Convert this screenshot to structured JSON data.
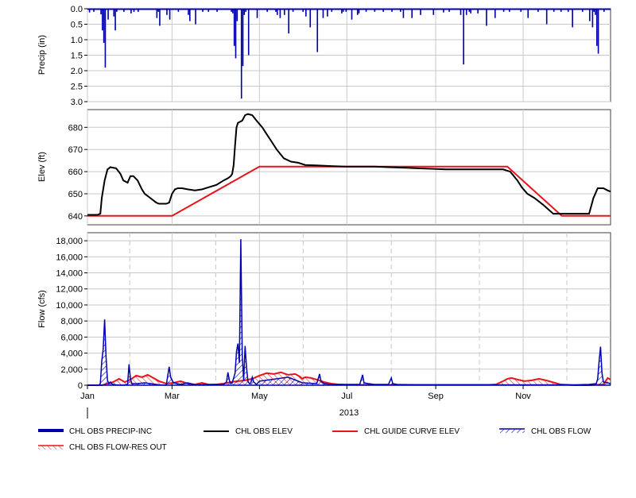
{
  "colors": {
    "precip": "#0000a8",
    "obs_elev": "#000000",
    "guide_curve": "#e8141c",
    "obs_flow": "#0000b4",
    "flow_res_out": "#e8141c",
    "grid": "#c8c8c8",
    "frame": "#404040"
  },
  "x_axis": {
    "tick_labels": [
      "Jan",
      "Mar",
      "May",
      "Jul",
      "Sep",
      "Nov"
    ],
    "tick_days": [
      0,
      59,
      120,
      181,
      243,
      304
    ],
    "range_days": [
      0,
      365
    ],
    "year_label": "2013"
  },
  "legend": {
    "precip": "CHL OBS PRECIP-INC",
    "obs_elev": "CHL OBS ELEV",
    "guide_curve": "CHL GUIDE CURVE ELEV",
    "obs_flow": "CHL OBS FLOW",
    "flow_res_out": "CHL OBS FLOW-RES OUT"
  },
  "chart_data": [
    {
      "type": "bar",
      "ylabel": "Precip (in)",
      "ylim": [
        0.0,
        3.0
      ],
      "y_inverted": true,
      "yticks": [
        "0.0",
        "0.5",
        "1.0",
        "1.5",
        "2.0",
        "2.5",
        "3.0"
      ],
      "series": [
        {
          "name": "CHL OBS PRECIP-INC",
          "x_days": [
            1,
            4,
            9,
            10,
            11,
            12,
            14,
            18,
            19,
            20,
            25,
            30,
            32,
            35,
            48,
            49,
            50,
            55,
            57,
            63,
            70,
            71,
            75,
            80,
            84,
            90,
            100,
            101,
            102,
            103,
            104,
            107,
            108,
            109,
            110,
            112,
            118,
            125,
            131,
            132,
            134,
            137,
            140,
            143,
            150,
            152,
            155,
            160,
            164,
            167,
            170,
            177,
            178,
            180,
            184,
            188,
            189,
            194,
            200,
            206,
            212,
            218,
            220,
            226,
            232,
            241,
            248,
            252,
            260,
            262,
            264,
            266,
            267,
            272,
            278,
            284,
            290,
            294,
            302,
            307,
            314,
            320,
            325,
            330,
            335,
            338,
            345,
            350,
            352,
            353,
            354,
            355,
            356,
            360
          ],
          "values": [
            0.12,
            0.1,
            0.18,
            0.7,
            1.1,
            1.9,
            0.35,
            0.25,
            0.7,
            0.1,
            0.1,
            0.15,
            0.1,
            0.1,
            0.3,
            0.1,
            0.55,
            0.2,
            0.35,
            0.1,
            0.2,
            0.4,
            0.5,
            0.1,
            0.1,
            0.1,
            0.1,
            0.15,
            1.2,
            1.6,
            0.4,
            2.9,
            1.85,
            0.2,
            0.1,
            1.5,
            0.3,
            0.1,
            0.1,
            0.2,
            0.3,
            0.2,
            0.8,
            0.1,
            0.1,
            0.25,
            0.6,
            1.4,
            0.3,
            0.25,
            0.1,
            0.15,
            0.1,
            0.1,
            0.35,
            0.2,
            0.15,
            0.1,
            0.1,
            0.1,
            0.1,
            0.1,
            0.3,
            0.3,
            0.2,
            0.2,
            0.12,
            0.1,
            0.2,
            1.8,
            0.2,
            0.1,
            0.15,
            0.15,
            0.55,
            0.3,
            0.1,
            0.1,
            0.1,
            0.3,
            0.1,
            0.5,
            0.1,
            0.1,
            0.1,
            0.6,
            0.1,
            0.4,
            0.6,
            0.1,
            0.2,
            1.2,
            1.45,
            0.1
          ]
        }
      ]
    },
    {
      "type": "line",
      "ylabel": "Elev (ft)",
      "ylim": [
        636,
        688
      ],
      "yticks": [
        640,
        650,
        660,
        670,
        680
      ],
      "series": [
        {
          "name": "CHL OBS ELEV",
          "x_days": [
            0,
            7,
            9,
            10,
            12,
            14,
            16,
            20,
            23,
            25,
            28,
            30,
            32,
            35,
            38,
            40,
            44,
            48,
            50,
            52,
            55,
            57,
            59,
            61,
            63,
            66,
            70,
            75,
            80,
            85,
            90,
            95,
            98,
            100,
            101,
            102,
            103,
            104,
            105,
            108,
            110,
            112,
            115,
            118,
            122,
            125,
            128,
            132,
            137,
            142,
            147,
            152,
            160,
            170,
            180,
            190,
            200,
            210,
            220,
            230,
            240,
            250,
            260,
            270,
            280,
            290,
            295,
            300,
            303,
            307,
            312,
            318,
            325,
            331,
            335,
            340,
            345,
            350,
            353,
            356,
            360,
            363,
            365
          ],
          "values": [
            640.5,
            640.5,
            641,
            648,
            656,
            661,
            662,
            661.5,
            659,
            656,
            655,
            658,
            658,
            656,
            652,
            650,
            648,
            646,
            645.5,
            645.5,
            645.5,
            646,
            650,
            652,
            652.5,
            652.5,
            652,
            651.5,
            652,
            653,
            654,
            656,
            657,
            658,
            659,
            663,
            672,
            680,
            682,
            683,
            685.5,
            686,
            685.5,
            683,
            680,
            677,
            674,
            670,
            666,
            664.5,
            664,
            663,
            662.8,
            662.5,
            662.3,
            662.3,
            662.3,
            662,
            661.8,
            661.5,
            661.3,
            661,
            661,
            661,
            661,
            661,
            660,
            656,
            653,
            650,
            648,
            645,
            641,
            641,
            641,
            641,
            641,
            641,
            648,
            652.5,
            652.5,
            651.5,
            651
          ]
        },
        {
          "name": "CHL GUIDE CURVE ELEV",
          "x_days": [
            0,
            59,
            120,
            293,
            331,
            365
          ],
          "values": [
            640,
            640,
            662.3,
            662.3,
            640,
            640
          ]
        }
      ]
    },
    {
      "type": "area",
      "ylabel": "Flow (cfs)",
      "ylim": [
        0,
        19000
      ],
      "yticks": [
        "0",
        "2,000",
        "4,000",
        "6,000",
        "8,000",
        "10,000",
        "12,000",
        "14,000",
        "16,000",
        "18,000"
      ],
      "series": [
        {
          "name": "CHL OBS FLOW",
          "x_days": [
            0,
            8,
            9,
            10,
            11,
            12,
            13,
            14,
            15,
            16,
            17,
            18,
            20,
            25,
            28,
            29,
            30,
            31,
            35,
            40,
            50,
            55,
            56,
            57,
            58,
            60,
            65,
            70,
            75,
            85,
            95,
            97,
            98,
            99,
            100,
            101,
            103,
            104,
            105,
            106,
            107,
            108,
            109,
            110,
            111,
            112,
            113,
            114,
            115,
            116,
            118,
            120,
            140,
            150,
            160,
            162,
            163,
            165,
            170,
            180,
            190,
            192,
            193,
            196,
            200,
            210,
            212,
            213,
            216,
            230,
            260,
            280,
            300,
            320,
            340,
            350,
            355,
            356,
            357,
            358,
            359,
            360,
            363,
            365
          ],
          "values": [
            0,
            0,
            200,
            3000,
            4500,
            8200,
            3500,
            600,
            200,
            400,
            200,
            100,
            50,
            0,
            100,
            2600,
            800,
            200,
            200,
            300,
            50,
            0,
            1200,
            2300,
            1000,
            300,
            100,
            300,
            50,
            100,
            100,
            400,
            1600,
            600,
            200,
            300,
            1500,
            4200,
            5200,
            2800,
            18200,
            3800,
            600,
            4900,
            2200,
            500,
            200,
            300,
            1000,
            400,
            100,
            500,
            1000,
            300,
            200,
            1400,
            500,
            200,
            100,
            100,
            100,
            1300,
            300,
            200,
            100,
            100,
            900,
            200,
            100,
            50,
            50,
            50,
            50,
            50,
            50,
            100,
            200,
            800,
            3000,
            4800,
            1500,
            400,
            300,
            200
          ]
        },
        {
          "name": "CHL OBS FLOW-RES OUT",
          "x_days": [
            0,
            10,
            14,
            18,
            22,
            26,
            30,
            34,
            38,
            42,
            46,
            50,
            55,
            60,
            65,
            70,
            75,
            80,
            85,
            90,
            95,
            100,
            105,
            110,
            115,
            120,
            125,
            130,
            135,
            140,
            145,
            148,
            150,
            152,
            156,
            160,
            165,
            170,
            175,
            180,
            190,
            200,
            220,
            240,
            260,
            280,
            285,
            290,
            293,
            296,
            300,
            305,
            310,
            315,
            320,
            330,
            340,
            350,
            360,
            363,
            365
          ],
          "values": [
            0,
            0,
            200,
            400,
            800,
            400,
            700,
            1200,
            1000,
            1300,
            900,
            500,
            200,
            300,
            500,
            200,
            100,
            300,
            50,
            100,
            200,
            400,
            500,
            600,
            800,
            1200,
            1500,
            1400,
            1600,
            1300,
            1400,
            1100,
            800,
            1000,
            900,
            700,
            400,
            200,
            100,
            50,
            50,
            50,
            50,
            50,
            50,
            50,
            100,
            500,
            800,
            900,
            700,
            500,
            600,
            800,
            600,
            100,
            0,
            0,
            100,
            900,
            700
          ]
        }
      ]
    }
  ]
}
